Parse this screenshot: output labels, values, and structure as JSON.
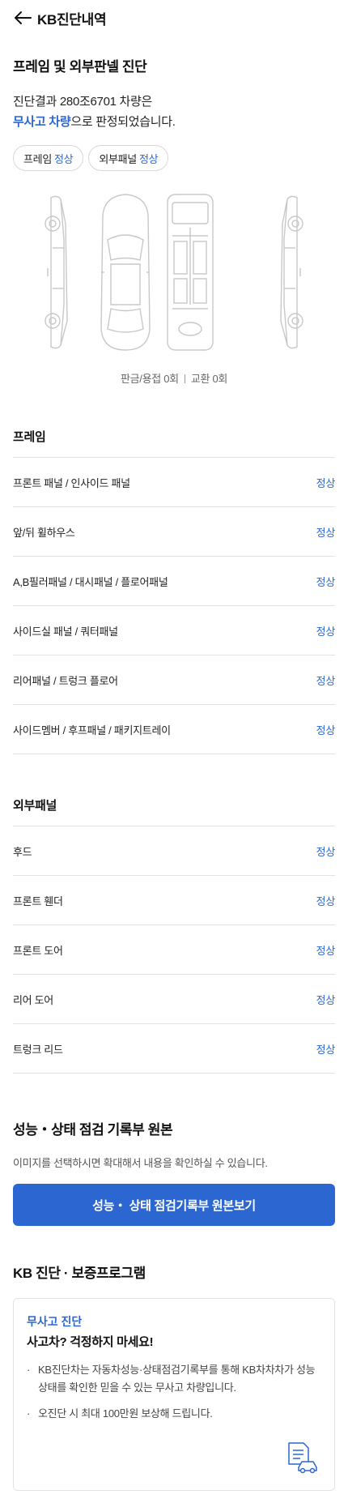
{
  "header": {
    "title": "KB진단내역"
  },
  "diagnosis": {
    "title": "프레임 및 외부판넬 진단",
    "summary_line1": "진단결과 280조6701 차량은",
    "summary_highlight": "무사고 차량",
    "summary_line2_rest": "으로 판정되었습니다.",
    "chips": [
      {
        "label": "프레임",
        "status": "정상"
      },
      {
        "label": "외부패널",
        "status": "정상"
      }
    ],
    "caption_left": "판금/용접 0회",
    "caption_right": "교환 0회"
  },
  "frame": {
    "title": "프레임",
    "rows": [
      {
        "label": "프론트 패널 / 인사이드 패널",
        "status": "정상"
      },
      {
        "label": "앞/뒤 휠하우스",
        "status": "정상"
      },
      {
        "label": "A,B필러패널 / 대시패널 / 플로어패널",
        "status": "정상"
      },
      {
        "label": "사이드실 패널 / 쿼터패널",
        "status": "정상"
      },
      {
        "label": "리어패널 / 트렁크 플로어",
        "status": "정상"
      },
      {
        "label": "사이드멤버 / 후프패널 / 패키지트레이",
        "status": "정상"
      }
    ]
  },
  "outer_panel": {
    "title": "외부패널",
    "rows": [
      {
        "label": "후드",
        "status": "정상"
      },
      {
        "label": "프론트 휀더",
        "status": "정상"
      },
      {
        "label": "프론트 도어",
        "status": "정상"
      },
      {
        "label": "리어 도어",
        "status": "정상"
      },
      {
        "label": "트렁크 리드",
        "status": "정상"
      }
    ]
  },
  "record": {
    "title": "성능・상태 점검 기록부 원본",
    "description": "이미지를 선택하시면 확대해서 내용을 확인하실 수 있습니다.",
    "button_label": "성능・ 상태 점검기록부 원본보기"
  },
  "program": {
    "title": "KB 진단 · 보증프로그램",
    "tag": "무사고 진단",
    "headline": "사고차? 걱정하지 마세요!",
    "bullets": [
      "KB진단차는 자동차성능·상태점검기록부를 통해 KB차차차가 성능상태를 확인한 믿을 수 있는 무사고 차량입니다.",
      "오진단 시 최대 100만원 보상해 드립니다."
    ]
  },
  "colors": {
    "accent": "#2c67d1",
    "divider": "#e3e3e3"
  }
}
